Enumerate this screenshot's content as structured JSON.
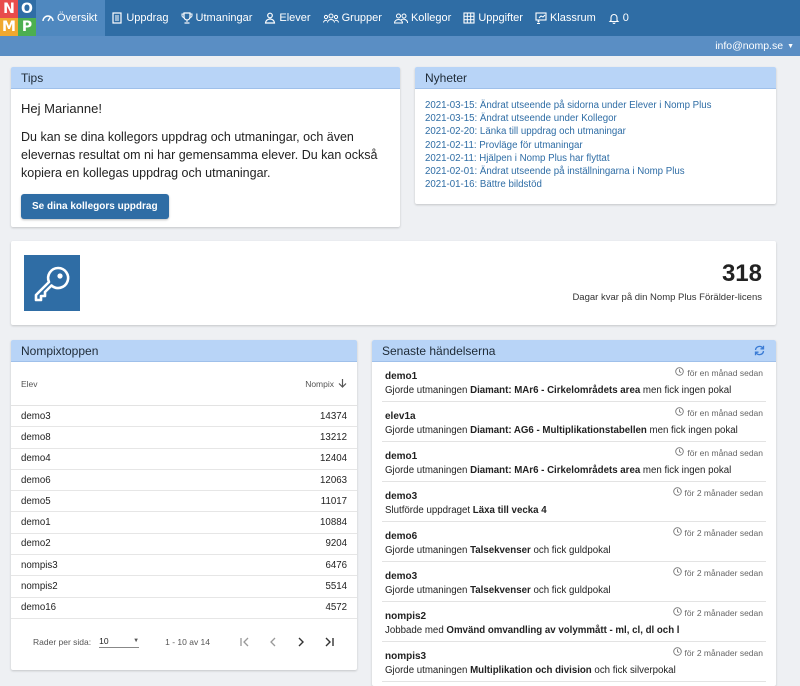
{
  "logo": {
    "letters": [
      "N",
      "O",
      "M",
      "P"
    ],
    "colors": [
      "#e84c4c",
      "#2f6da5",
      "#f0a830",
      "#4caf50"
    ]
  },
  "nav": {
    "items": [
      {
        "label": "Översikt",
        "icon": "dashboard-icon",
        "active": true
      },
      {
        "label": "Uppdrag",
        "icon": "document-icon"
      },
      {
        "label": "Utmaningar",
        "icon": "trophy-icon"
      },
      {
        "label": "Elever",
        "icon": "person-icon"
      },
      {
        "label": "Grupper",
        "icon": "group-icon"
      },
      {
        "label": "Kollegor",
        "icon": "colleagues-icon"
      },
      {
        "label": "Uppgifter",
        "icon": "grid-icon"
      },
      {
        "label": "Klassrum",
        "icon": "classroom-icon"
      },
      {
        "label": "0",
        "icon": "bell-icon"
      }
    ],
    "user": "info@nomp.se"
  },
  "tips": {
    "title": "Tips",
    "greeting": "Hej Marianne!",
    "text": "Du kan se dina kollegors uppdrag och utmaningar, och även elevernas resultat om ni har gemensamma elever. Du kan också kopiera en kollegas uppdrag och utmaningar.",
    "button": "Se dina kollegors uppdrag"
  },
  "news": {
    "title": "Nyheter",
    "items": [
      "2021-03-15: Ändrat utseende på sidorna under Elever i Nomp Plus",
      "2021-03-15: Ändrat utseende under Kollegor",
      "2021-02-20: Länka till uppdrag och utmaningar",
      "2021-02-11: Provläge för utmaningar",
      "2021-02-11: Hjälpen i Nomp Plus har flyttat",
      "2021-02-01: Ändrat utseende på inställningarna i Nomp Plus",
      "2021-01-16: Bättre bildstöd"
    ]
  },
  "license": {
    "days": "318",
    "label": "Dagar kvar på din Nomp Plus Förälder-licens"
  },
  "leaderboard": {
    "title": "Nompixtoppen",
    "col_student": "Elev",
    "col_points": "Nompix",
    "rows": [
      {
        "name": "demo3",
        "points": "14374"
      },
      {
        "name": "demo8",
        "points": "13212"
      },
      {
        "name": "demo4",
        "points": "12404"
      },
      {
        "name": "demo6",
        "points": "12063"
      },
      {
        "name": "demo5",
        "points": "11017"
      },
      {
        "name": "demo1",
        "points": "10884"
      },
      {
        "name": "demo2",
        "points": "9204"
      },
      {
        "name": "nompis3",
        "points": "6476"
      },
      {
        "name": "nompis2",
        "points": "5514"
      },
      {
        "name": "demo16",
        "points": "4572"
      }
    ],
    "rows_per_page_label": "Rader per sida:",
    "rows_per_page": "10",
    "range": "1 - 10 av 14"
  },
  "events": {
    "title": "Senaste händelserna",
    "items": [
      {
        "user": "demo1",
        "time": "för en månad sedan",
        "pre": "Gjorde utmaningen ",
        "bold": "Diamant: MAr6 - Cirkelområdets area",
        "post": " men fick ingen pokal"
      },
      {
        "user": "elev1a",
        "time": "för en månad sedan",
        "pre": "Gjorde utmaningen ",
        "bold": "Diamant: AG6 - Multiplikationstabellen",
        "post": " men fick ingen pokal"
      },
      {
        "user": "demo1",
        "time": "för en månad sedan",
        "pre": "Gjorde utmaningen ",
        "bold": "Diamant: MAr6 - Cirkelområdets area",
        "post": " men fick ingen pokal"
      },
      {
        "user": "demo3",
        "time": "för 2 månader sedan",
        "pre": "Slutförde uppdraget ",
        "bold": "Läxa till vecka 4",
        "post": ""
      },
      {
        "user": "demo6",
        "time": "för 2 månader sedan",
        "pre": "Gjorde utmaningen ",
        "bold": "Talsekvenser",
        "post": " och fick guldpokal"
      },
      {
        "user": "demo3",
        "time": "för 2 månader sedan",
        "pre": "Gjorde utmaningen ",
        "bold": "Talsekvenser",
        "post": " och fick guldpokal"
      },
      {
        "user": "nompis2",
        "time": "för 2 månader sedan",
        "pre": "Jobbade med ",
        "bold": "Omvänd omvandling av volymmått - ml, cl, dl och l",
        "post": ""
      },
      {
        "user": "nompis3",
        "time": "för 2 månader sedan",
        "pre": "Gjorde utmaningen ",
        "bold": "Multiplikation och division",
        "post": " och fick silverpokal"
      }
    ]
  }
}
